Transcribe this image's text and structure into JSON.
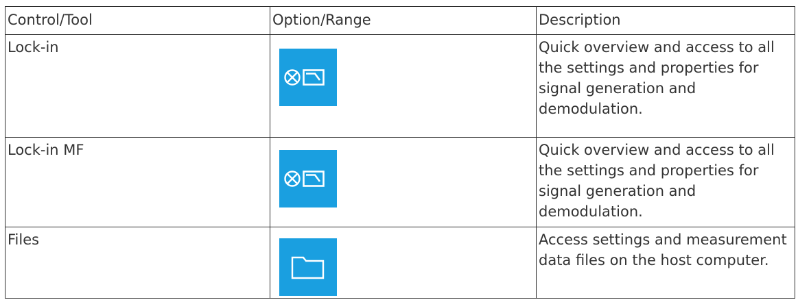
{
  "table": {
    "headers": [
      "Control/Tool",
      "Option/Range",
      "Description"
    ],
    "rows": [
      {
        "tool": "Lock-in",
        "icon": "lock-in-icon",
        "description": "Quick overview and access to all the settings and properties for signal generation and demodulation."
      },
      {
        "tool": "Lock-in MF",
        "icon": "lock-in-icon",
        "description": "Quick overview and access to all the settings and properties for signal generation and demodulation."
      },
      {
        "tool": "Files",
        "icon": "folder-icon",
        "description": "Access settings and measurement data files on the host computer."
      }
    ]
  },
  "colors": {
    "icon_background": "#1a9fe0",
    "icon_foreground": "#ffffff",
    "border": "#2b2b2b",
    "text": "#333333"
  }
}
